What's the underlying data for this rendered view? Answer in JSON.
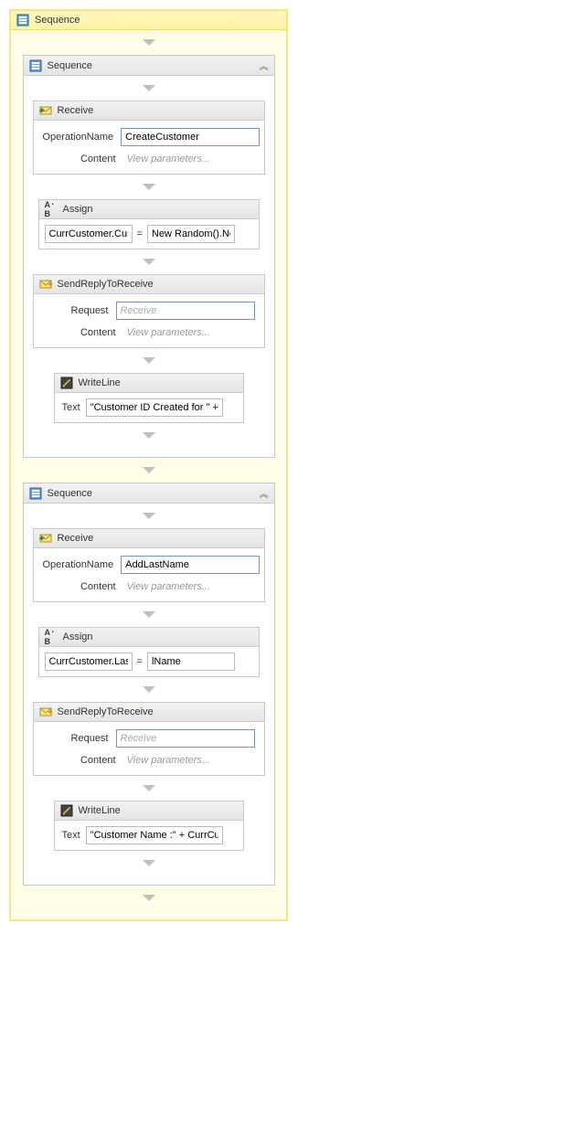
{
  "outerSequence": {
    "title": "Sequence"
  },
  "seq1": {
    "title": "Sequence",
    "receive": {
      "title": "Receive",
      "opNameLabel": "OperationName",
      "opNameValue": "CreateCustomer",
      "contentLabel": "Content",
      "contentPlaceholder": "View parameters..."
    },
    "assign": {
      "title": "Assign",
      "left": "CurrCustomer.Custom",
      "right": "New Random().Next"
    },
    "reply": {
      "title": "SendReplyToReceive",
      "requestLabel": "Request",
      "requestPlaceholder": "Receive",
      "contentLabel": "Content",
      "contentPlaceholder": "View parameters..."
    },
    "writeLine": {
      "title": "WriteLine",
      "textLabel": "Text",
      "textValue": "\"Customer ID Created for \" + Cu"
    }
  },
  "seq2": {
    "title": "Sequence",
    "receive": {
      "title": "Receive",
      "opNameLabel": "OperationName",
      "opNameValue": "AddLastName",
      "contentLabel": "Content",
      "contentPlaceholder": "View parameters..."
    },
    "assign": {
      "title": "Assign",
      "left": "CurrCustomer.LastNa",
      "right": "lName"
    },
    "reply": {
      "title": "SendReplyToReceive",
      "requestLabel": "Request",
      "requestPlaceholder": "Receive",
      "contentLabel": "Content",
      "contentPlaceholder": "View parameters..."
    },
    "writeLine": {
      "title": "WriteLine",
      "textLabel": "Text",
      "textValue": "\"Customer Name :\" + CurrCustc"
    }
  },
  "glyphs": {
    "equals": "=",
    "collapse": "︽"
  }
}
